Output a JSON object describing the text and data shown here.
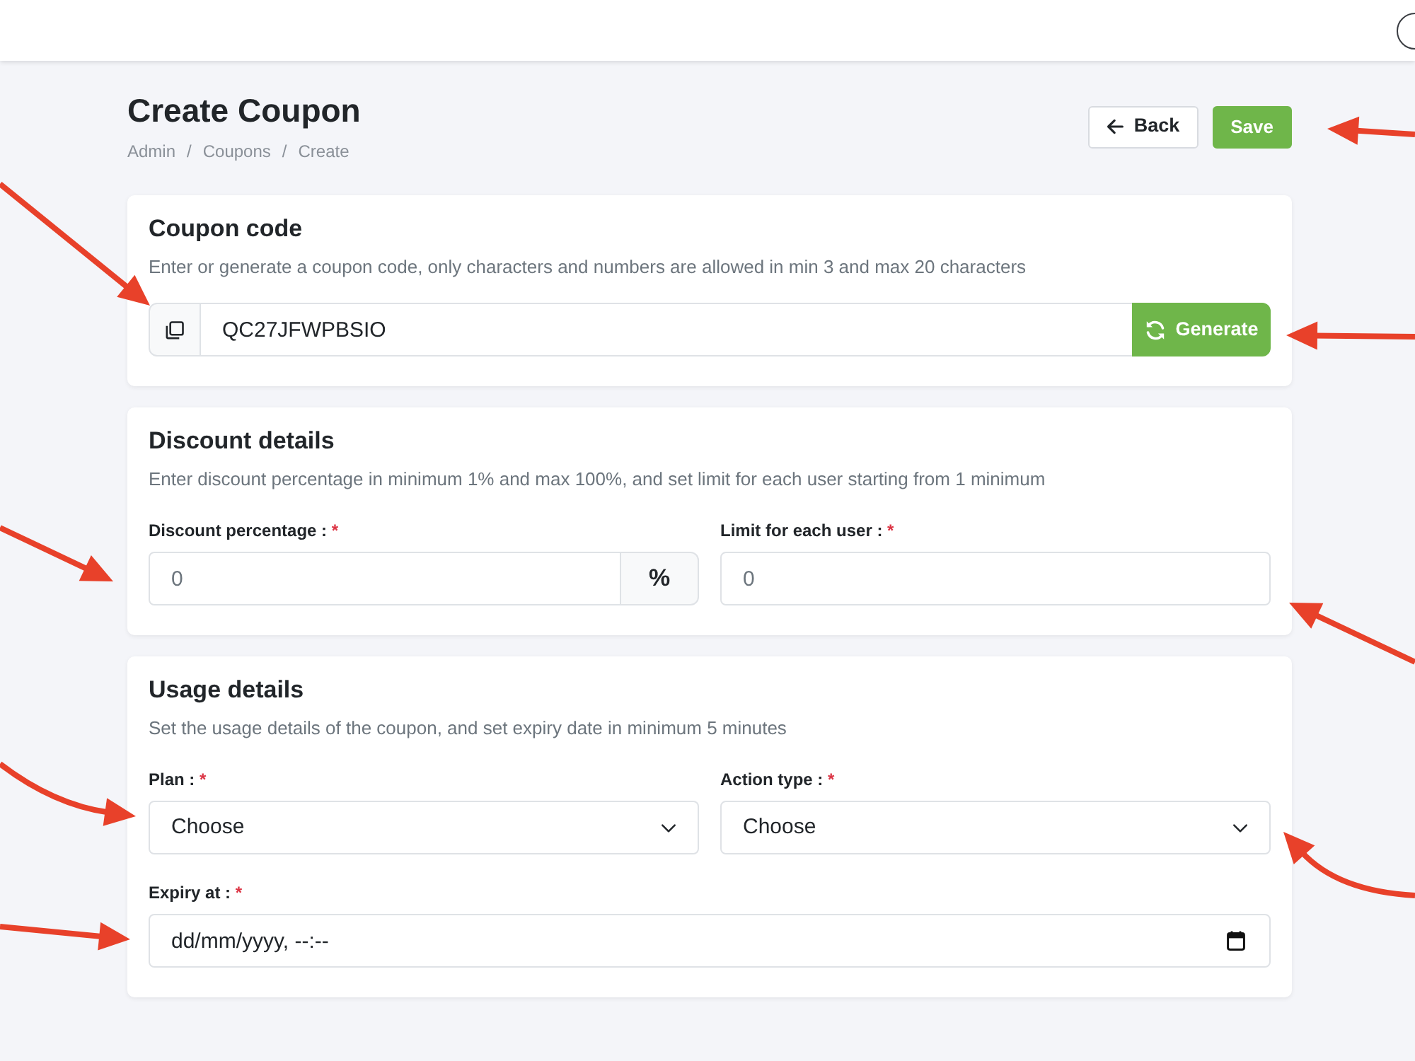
{
  "page_header": {
    "title": "Create Coupon",
    "breadcrumb": {
      "items": [
        "Admin",
        "Coupons",
        "Create"
      ],
      "separator": "/"
    },
    "buttons": [
      {
        "kind": "back",
        "label": "Back"
      },
      {
        "kind": "save",
        "label": "Save"
      }
    ]
  },
  "sections": [
    {
      "title": "Coupon code",
      "description": "Enter or generate a coupon code, only characters and numbers are allowed in min 3 and max 20 characters",
      "rows": [
        [
          {
            "kind": "code",
            "value": "QC27JFWPBSIO",
            "button": "Generate"
          }
        ]
      ]
    },
    {
      "title": "Discount details",
      "description": "Enter discount percentage in minimum 1% and max 100%, and set limit for each user starting from 1 minimum",
      "rows": [
        [
          {
            "kind": "number",
            "label": "Discount percentage :",
            "required_mark": "*",
            "placeholder": "0",
            "suffix": "%"
          },
          {
            "kind": "number",
            "label": "Limit for each user :",
            "required_mark": "*",
            "placeholder": "0"
          }
        ]
      ]
    },
    {
      "title": "Usage details",
      "description": "Set the usage details of the coupon, and set expiry date in minimum 5 minutes",
      "rows": [
        [
          {
            "kind": "select",
            "label": "Plan :",
            "required_mark": "*",
            "value": "Choose"
          },
          {
            "kind": "select",
            "label": "Action type :",
            "required_mark": "*",
            "value": "Choose"
          }
        ],
        [
          {
            "kind": "datetime",
            "label": "Expiry at :",
            "required_mark": "*",
            "placeholder": "dd/mm/yyyy, --:--"
          }
        ]
      ]
    }
  ]
}
